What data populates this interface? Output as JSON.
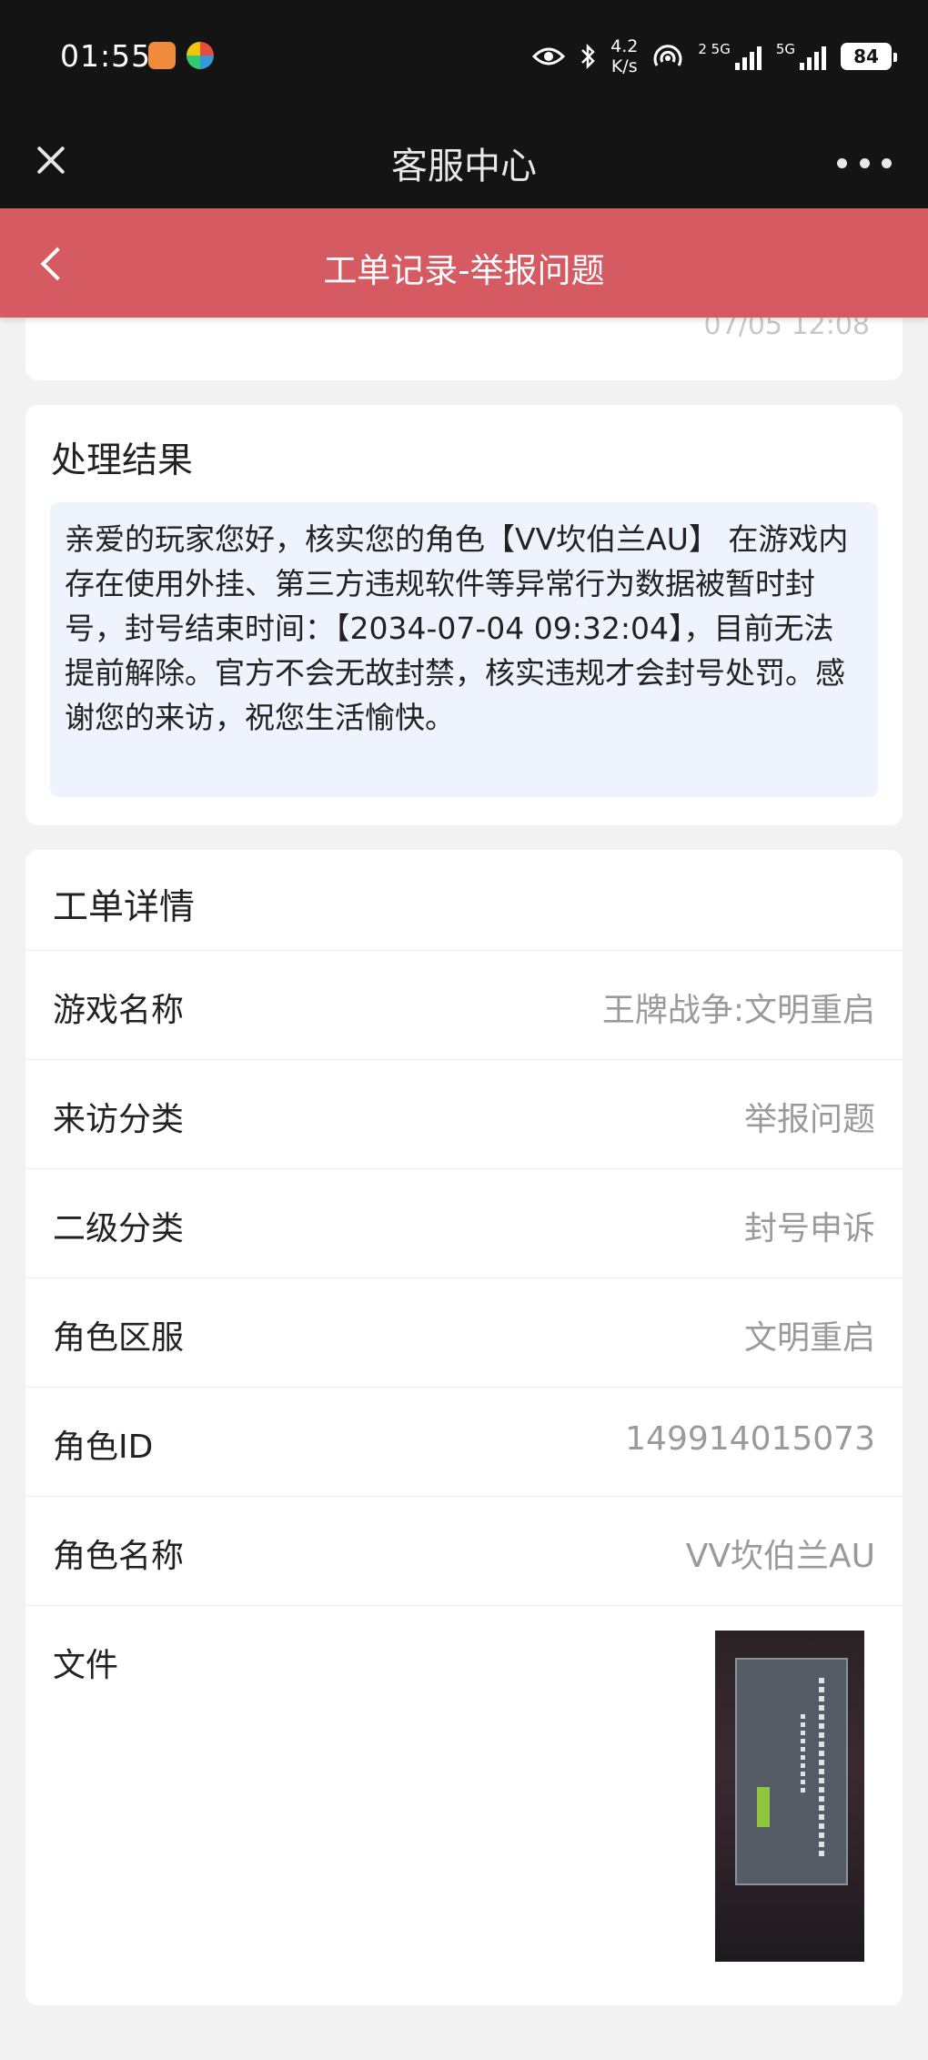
{
  "status_bar": {
    "time": "01:55",
    "net_speed_value": "4.2",
    "net_speed_unit": "K/s",
    "sim1_label": "2 5G",
    "sim2_label": "5G",
    "battery": "84"
  },
  "title_bar": {
    "title": "客服中心"
  },
  "header": {
    "title": "工单记录-举报问题"
  },
  "previous_card": {
    "time": "07/05 12:08"
  },
  "result": {
    "title": "处理结果",
    "text": "亲爱的玩家您好，核实您的角色【VV坎伯兰AU】 在游戏内存在使用外挂、第三方违规软件等异常行为数据被暂时封号，封号结束时间：【2034-07-04 09:32:04】，目前无法提前解除。官方不会无故封禁，核实违规才会封号处罚。感谢您的来访，祝您生活愉快。"
  },
  "detail": {
    "title": "工单详情",
    "rows": [
      {
        "label": "游戏名称",
        "value": "王牌战争:文明重启"
      },
      {
        "label": "来访分类",
        "value": "举报问题"
      },
      {
        "label": "二级分类",
        "value": "封号申诉"
      },
      {
        "label": "角色区服",
        "value": "文明重启"
      },
      {
        "label": "角色ID",
        "value": "149914015073"
      },
      {
        "label": "角色名称",
        "value": "VV坎伯兰AU"
      }
    ],
    "file_label": "文件"
  },
  "icons": {
    "close": "close-icon",
    "more": "more-icon",
    "back": "back-arrow-icon",
    "eye": "eye-icon",
    "bluetooth": "bluetooth-icon",
    "hotspot": "hotspot-icon",
    "signal": "signal-icon",
    "battery": "battery-icon"
  },
  "colors": {
    "header_bg": "#d65a62",
    "title_bar_bg": "#141414",
    "page_bg": "#f2f2f2",
    "result_box_bg": "#eef3fd"
  }
}
